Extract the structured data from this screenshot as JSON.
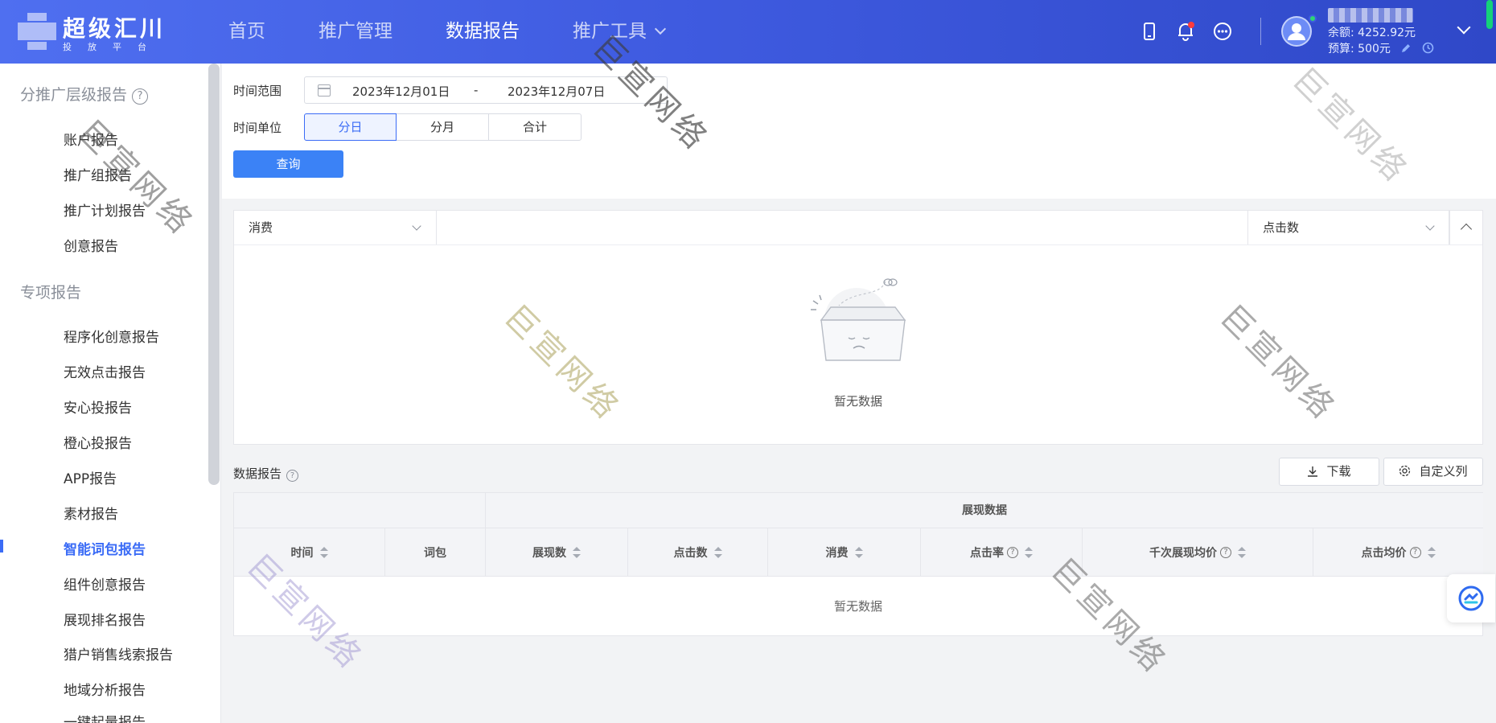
{
  "header": {
    "logo_title": "超级汇川",
    "logo_subtitle": "投放平台",
    "nav": [
      {
        "label": "首页"
      },
      {
        "label": "推广管理"
      },
      {
        "label": "数据报告"
      },
      {
        "label": "推广工具"
      }
    ],
    "balance": "余额: 4252.92元",
    "budget": "预算: 500元"
  },
  "sidebar": {
    "group1": "分推广层级报告",
    "group1_items": [
      "账户报告",
      "推广组报告",
      "推广计划报告",
      "创意报告"
    ],
    "group2": "专项报告",
    "group2_items": [
      "程序化创意报告",
      "无效点击报告",
      "安心投报告",
      "橙心投报告",
      "APP报告",
      "素材报告",
      "智能词包报告",
      "组件创意报告",
      "展现排名报告",
      "猎户销售线索报告",
      "地域分析报告",
      "一键起量报告"
    ],
    "active_item": "智能词包报告"
  },
  "filter": {
    "time_range_label": "时间范围",
    "start_date": "2023年12月01日",
    "separator": "-",
    "end_date": "2023年12月07日",
    "time_unit_label": "时间单位",
    "units": [
      "分日",
      "分月",
      "合计"
    ],
    "active_unit": "分日",
    "query_button": "查询"
  },
  "chart": {
    "left_metric": "消费",
    "right_metric": "点击数",
    "empty_text": "暂无数据"
  },
  "report": {
    "title": "数据报告",
    "download_button": "下载",
    "custom_columns_button": "自定义列",
    "group_header": "展现数据",
    "columns": [
      "时间",
      "词包",
      "展现数",
      "点击数",
      "消费",
      "点击率",
      "千次展现均价",
      "点击均价"
    ],
    "empty_text": "暂无数据"
  },
  "watermark_text": "巨宣网络",
  "colors": {
    "header_start": "#4f6ff0",
    "header_end": "#2f48c8",
    "accent": "#3b6cf6",
    "query_button": "#3b82f6"
  }
}
